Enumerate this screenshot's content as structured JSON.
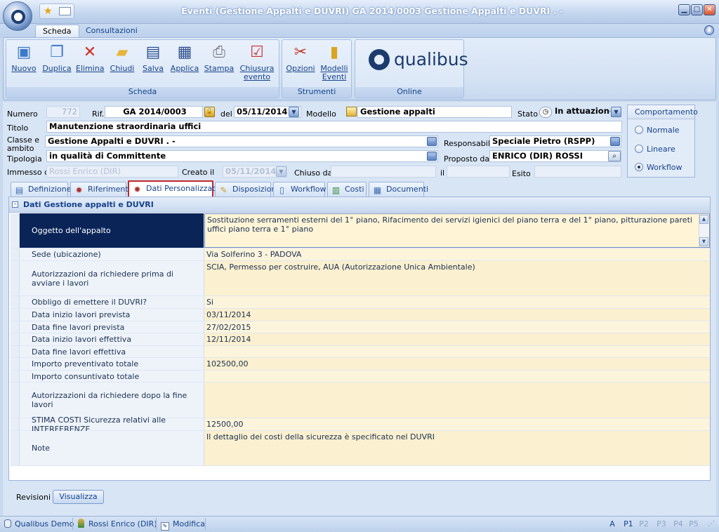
{
  "window": {
    "title": "Eventi (Gestione Appalti e DUVRI)  GA 2014/0003 Gestione Appalti e DUVRI . -"
  },
  "ribbon": {
    "tabs": [
      "Scheda",
      "Consultazioni"
    ],
    "groups": {
      "scheda": {
        "label": "Scheda",
        "buttons": [
          "Nuovo",
          "Duplica",
          "Elimina",
          "Chiudi",
          "Salva",
          "Applica",
          "Stampa",
          "Chiusura evento"
        ]
      },
      "strumenti": {
        "label": "Strumenti",
        "buttons": [
          "Opzioni",
          "Modelli Eventi"
        ]
      },
      "online": {
        "label": "Online",
        "logo_text": "qualibus"
      }
    }
  },
  "header": {
    "numero_label": "Numero",
    "numero": "772",
    "rif_label": "Rif.",
    "rif": "GA 2014/0003",
    "del_label": "del",
    "del": "05/11/2014",
    "modello_label": "Modello",
    "modello": "Gestione appalti",
    "stato_label": "Stato",
    "stato": "In attuazione",
    "titolo_label": "Titolo",
    "titolo": "Manutenzione straordinaria uffici",
    "classe_label": "Classe e ambito",
    "classe": "Gestione Appalti e DUVRI . -",
    "responsabile_label": "Responsabile",
    "responsabile": "Speciale Pietro (RSPP)",
    "tipologia_label": "Tipologia",
    "tipologia": "in qualità di Committente",
    "proposto_label": "Proposto da",
    "proposto": "ENRICO (DIR) ROSSI",
    "immesso_label": "Immesso da",
    "immesso": "Rossi Enrico (DIR)",
    "creato_label": "Creato il",
    "creato": "05/11/2014",
    "chiuso_label": "Chiuso da",
    "il_label": "il",
    "esito_label": "Esito"
  },
  "comportamento": {
    "title": "Comportamento",
    "options": [
      "Normale",
      "Lineare",
      "Workflow"
    ],
    "selected": "Workflow"
  },
  "tabs": [
    "Definizione",
    "Riferimenti",
    "Dati Personalizzati",
    "Disposizioni",
    "Workflow",
    "Costi",
    "Documenti"
  ],
  "active_tab": "Dati Personalizzati",
  "panel": {
    "title": "Dati Gestione appalti e DUVRI",
    "rows": [
      {
        "key": "Oggetto dell'appalto",
        "value": "Sostituzione serramenti esterni del 1° piano, Rifacimento dei servizi igienici del piano terra e del 1° piano, pitturazione pareti uffici piano terra e 1° piano"
      },
      {
        "key": "Sede (ubicazione)",
        "value": "Via Solferino 3 - PADOVA"
      },
      {
        "key": "Autorizzazioni da richiedere prima di avviare i lavori",
        "value": "SCIA, Permesso per costruire, AUA (Autorizzazione Unica Ambientale)"
      },
      {
        "key": "Obbligo di emettere il DUVRI?",
        "value": "Si"
      },
      {
        "key": "Data inizio lavori prevista",
        "value": "03/11/2014"
      },
      {
        "key": "Data fine lavori prevista",
        "value": "27/02/2015"
      },
      {
        "key": "Data inizio lavori effettiva",
        "value": "12/11/2014"
      },
      {
        "key": "Data fine lavori effettiva",
        "value": ""
      },
      {
        "key": "Importo preventivato totale",
        "value": "102500,00"
      },
      {
        "key": "Importo consuntivato totale",
        "value": ""
      },
      {
        "key": "Autorizzazioni da richiedere dopo la fine lavori",
        "value": ""
      },
      {
        "key": "STIMA COSTI Sicurezza relativi alle INTERFERENZE",
        "value": "12500,00"
      },
      {
        "key": "Note",
        "value": "Il dettaglio dei costi della sicurezza è specificato nel DUVRI"
      }
    ]
  },
  "revisioni": {
    "label": "Revisioni",
    "button": "Visualizza"
  },
  "statusbar": {
    "app": "Qualibus Demo",
    "user": "Rossi Enrico (DIR)",
    "mode": "Modifica",
    "priorities": [
      "A",
      "P1",
      "P2",
      "P3",
      "P4",
      "P5"
    ]
  }
}
